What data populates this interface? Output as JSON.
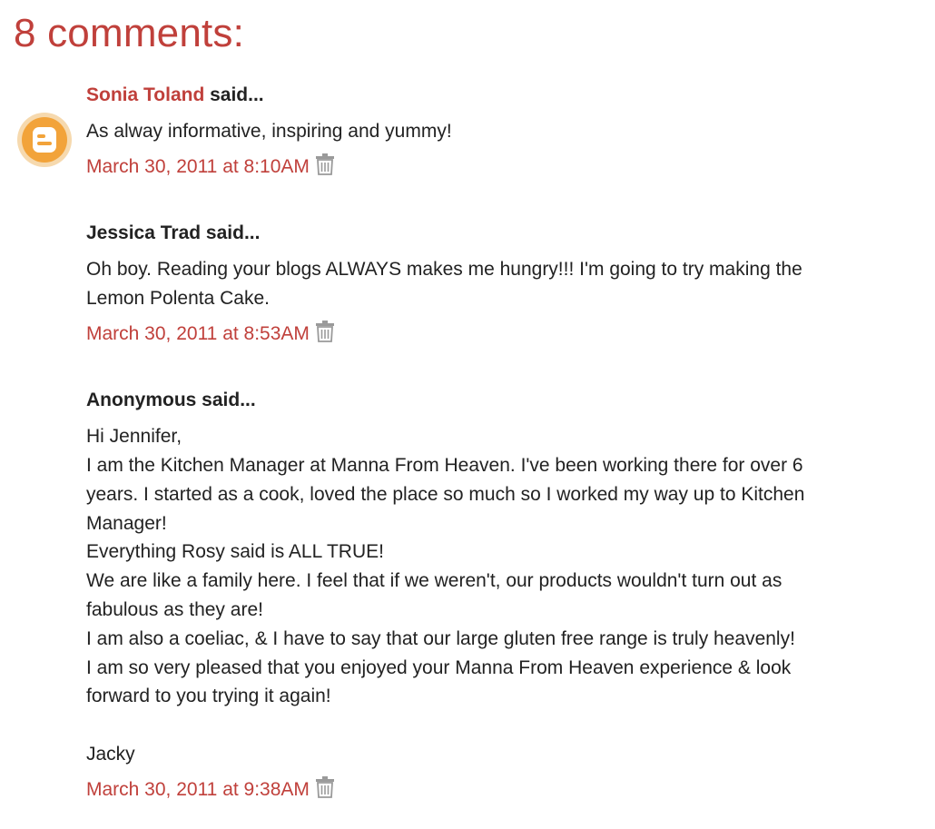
{
  "heading": "8 comments:",
  "comments": [
    {
      "author": "Sonia Toland",
      "author_is_link": true,
      "said": " said...",
      "lines": [
        "As alway informative, inspiring and yummy!"
      ],
      "timestamp": "March 30, 2011 at 8:10AM",
      "avatar": "blogger-icon"
    },
    {
      "author": "Jessica Trad",
      "author_is_link": false,
      "said": " said...",
      "lines": [
        "Oh boy. Reading your blogs ALWAYS makes me hungry!!! I'm going to try making the",
        "Lemon Polenta Cake."
      ],
      "timestamp": "March 30, 2011 at 8:53AM"
    },
    {
      "author": "Anonymous",
      "author_is_link": false,
      "said": " said...",
      "lines": [
        "Hi Jennifer,",
        "I am the Kitchen Manager at Manna From Heaven. I've been working there for over 6",
        "years. I started as a cook, loved the place so much so I worked my way up to Kitchen",
        "Manager!",
        "Everything Rosy said is ALL TRUE!",
        "We are like a family here. I feel that if we weren't, our products wouldn't turn out as",
        "fabulous as they are!",
        "I am also a coeliac, & I have to say that our large gluten free range is truly heavenly!",
        "I am so very pleased that you enjoyed your Manna From Heaven experience & look",
        "forward to you trying it again!",
        "",
        "Jacky"
      ],
      "timestamp": "March 30, 2011 at 9:38AM"
    }
  ],
  "colors": {
    "accent": "#c0403b",
    "text": "#222222",
    "avatar_orange": "#f2a33a",
    "trash_gray": "#9a9a9a"
  },
  "icons": {
    "delete": "trash-icon",
    "avatar": "blogger-icon"
  }
}
